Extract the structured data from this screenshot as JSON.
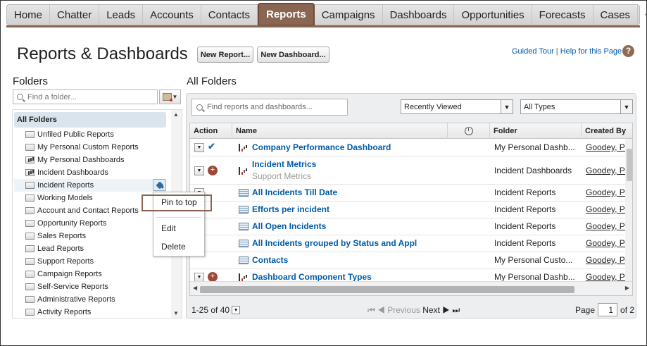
{
  "nav": {
    "tabs": [
      "Home",
      "Chatter",
      "Leads",
      "Accounts",
      "Contacts",
      "Reports",
      "Campaigns",
      "Dashboards",
      "Opportunities",
      "Forecasts",
      "Cases"
    ],
    "active_tab": "Reports",
    "plus_icon": "plus-icon",
    "more_icon": "chevron-down-icon"
  },
  "header": {
    "title": "Reports & Dashboards",
    "new_report": "New Report...",
    "new_dashboard": "New Dashboard...",
    "guided_tour": "Guided Tour",
    "separator": "|",
    "help": "Help for this Page",
    "help_icon": "?"
  },
  "sidebar": {
    "title": "Folders",
    "search_placeholder": "Find a folder...",
    "all_folders": "All Folders",
    "folders": [
      "Unfiled Public Reports",
      "My Personal Custom Reports",
      "My Personal Dashboards",
      "Incident Dashboards",
      "Incident Reports",
      "Working Models",
      "Account and Contact Reports",
      "Opportunity Reports",
      "Sales Reports",
      "Lead Reports",
      "Support Reports",
      "Campaign Reports",
      "Self-Service Reports",
      "Administrative Reports",
      "Activity Reports"
    ],
    "selected_folder": "Incident Reports"
  },
  "context_menu": {
    "pin": "Pin to top",
    "edit": "Edit",
    "delete": "Delete"
  },
  "main": {
    "title": "All Folders",
    "search_placeholder": "Find reports and dashboards...",
    "filter_view": "Recently Viewed",
    "filter_type": "All Types",
    "columns": {
      "action": "Action",
      "name": "Name",
      "folder": "Folder",
      "created_by": "Created By"
    },
    "rows": [
      {
        "name": "Company Performance Dashboard",
        "sub": "",
        "folder": "My Personal Dashb...",
        "created_by": "Goodey, Pa",
        "type": "dashboard",
        "status": "check"
      },
      {
        "name": "Incident Metrics",
        "sub": "Support Metrics",
        "folder": "Incident Dashboards",
        "created_by": "Goodey, Pa",
        "type": "dashboard",
        "status": "circle"
      },
      {
        "name": "All Incidents Till Date",
        "sub": "",
        "folder": "Incident Reports",
        "created_by": "Goodey, Pa",
        "type": "report",
        "status": ""
      },
      {
        "name": "Efforts per incident",
        "sub": "",
        "folder": "Incident Reports",
        "created_by": "Goodey, Pa",
        "type": "report",
        "status": ""
      },
      {
        "name": "All Open Incidents",
        "sub": "",
        "folder": "Incident Reports",
        "created_by": "Goodey, Pa",
        "type": "report",
        "status": ""
      },
      {
        "name": "All Incidents grouped by Status and Appl",
        "sub": "",
        "folder": "Incident Reports",
        "created_by": "Goodey, Pa",
        "type": "report",
        "status": ""
      },
      {
        "name": "Contacts",
        "sub": "",
        "folder": "My Personal Custo...",
        "created_by": "Goodey, Pa",
        "type": "report",
        "status": ""
      },
      {
        "name": "Dashboard Component Types",
        "sub": "",
        "folder": "My Personal Dashb...",
        "created_by": "Goodey, Pa",
        "type": "dashboard",
        "status": "circle"
      }
    ],
    "pager": {
      "range": "1-25 of 40",
      "previous": "Previous",
      "next": "Next",
      "page_label": "Page",
      "page_value": "1",
      "page_total": "of 2"
    }
  },
  "colors": {
    "accent": "#8a6552",
    "link": "#015ba7",
    "selection": "#d9e4ec"
  }
}
